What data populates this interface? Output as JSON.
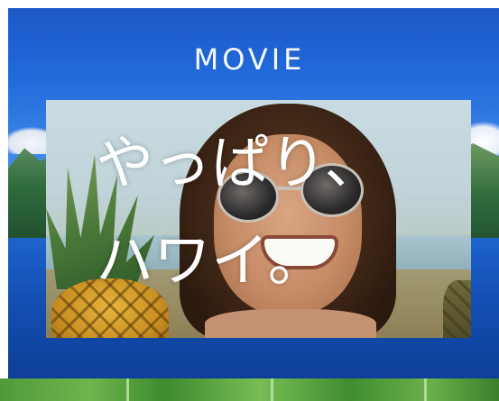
{
  "header": {
    "title": "MOVIE"
  },
  "hero": {
    "caption_line1": "やっぱり、",
    "caption_line2": "ハワイ。"
  },
  "colors": {
    "panel_blue": "#2169d9",
    "title_text": "#f4f8ff",
    "caption_text": "#ffffff",
    "leaf_green": "#4f9a3a"
  }
}
